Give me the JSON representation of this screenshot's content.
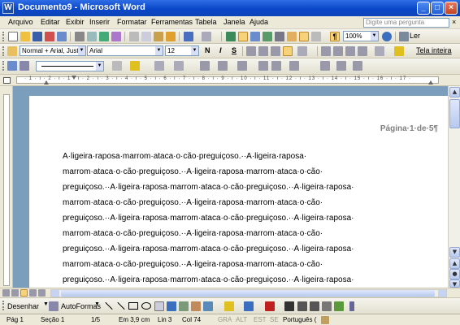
{
  "window": {
    "title": "Documento9 - Microsoft Word"
  },
  "menu": {
    "items": [
      "Arquivo",
      "Editar",
      "Exibir",
      "Inserir",
      "Formatar",
      "Ferramentas",
      "Tabela",
      "Janela",
      "Ajuda"
    ],
    "help_placeholder": "Digite uma pergunta"
  },
  "standard_toolbar": {
    "zoom": "100%",
    "read_label": "Ler"
  },
  "format_toolbar": {
    "style": "Normal + Arial, Justi",
    "font": "Arial",
    "size": "12",
    "bold": "N",
    "italic": "I",
    "underline": "S",
    "fullscreen_label": "Tela inteira"
  },
  "ruler": {
    "numbers": "· 1 · ı · 2 · ı · 1 · ı · 2 · ı · 3 · ı · 4 · ı · 5 · ı · 6 · ı · 7 · ı · 8 · ı · 9 · ı · 10 · ı · 11 · ı · 12 · ı · 13 · ı · 14 · ı · 15 · ı · 16 · ı · 17 ·"
  },
  "document": {
    "page_info": "Página·1·de·5¶",
    "lines": [
      "      A·ligeira·raposa·marrom·ataca·o·cão·preguiçoso.··A·ligeira·raposa·",
      "marrom·ataca·o·cão·preguiçoso.··A·ligeira·raposa·marrom·ataca·o·cão·",
      "preguiçoso.··A·ligeira·raposa·marrom·ataca·o·cão·preguiçoso.··A·ligeira·raposa·",
      "marrom·ataca·o·cão·preguiçoso.··A·ligeira·raposa·marrom·ataca·o·cão·",
      "preguiçoso.··A·ligeira·raposa·marrom·ataca·o·cão·preguiçoso.··A·ligeira·raposa·",
      "marrom·ataca·o·cão·preguiçoso.··A·ligeira·raposa·marrom·ataca·o·cão·",
      "preguiçoso.··A·ligeira·raposa·marrom·ataca·o·cão·preguiçoso.··A·ligeira·raposa·",
      "marrom·ataca·o·cão·preguiçoso.··A·ligeira·raposa·marrom·ataca·o·cão·",
      "preguiçoso.··A·ligeira·raposa·marrom·ataca·o·cão·preguiçoso.··A·ligeira·raposa·"
    ]
  },
  "drawing_toolbar": {
    "draw_label": "Desenhar",
    "autoshapes_label": "AutoFormas"
  },
  "status": {
    "page": "Pág 1",
    "section": "Seção 1",
    "pages": "1/5",
    "at": "Em 3,9 cm",
    "line": "Lin 3",
    "col": "Col 74",
    "rec": "GRA",
    "trk": "ALT",
    "ext": "EST",
    "ovr": "SE",
    "language": "Português ("
  },
  "colors": {
    "title_bar": "#0a47c9",
    "doc_background": "#7b9ebd",
    "chrome": "#ece9d8"
  }
}
